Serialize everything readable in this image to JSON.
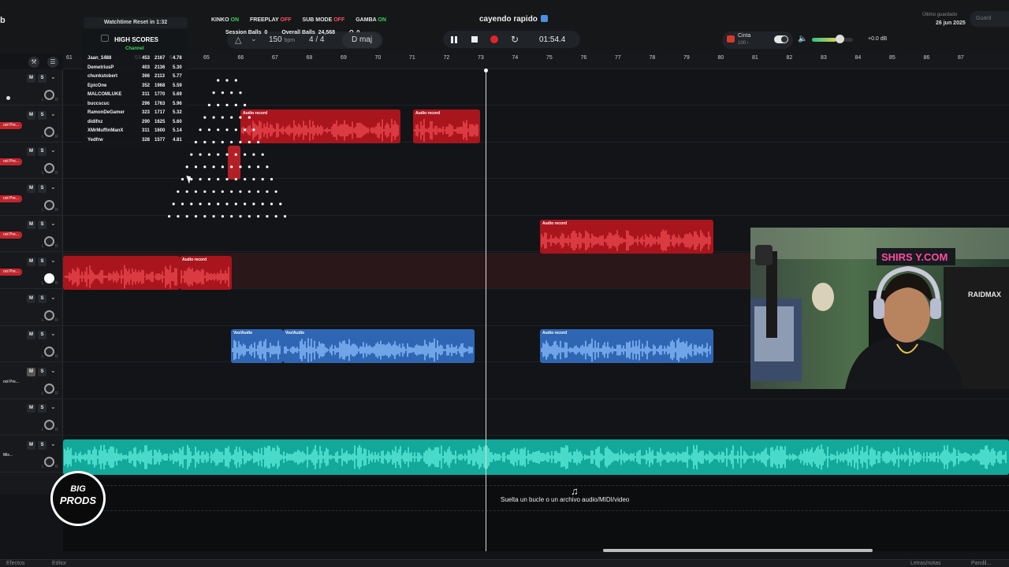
{
  "topbar": {
    "left_char": "b",
    "watchtime": "Watchtime Reset in 1:32",
    "modes": [
      {
        "label": "KINKO",
        "state": "ON"
      },
      {
        "label": "FREEPLAY",
        "state": "OFF"
      },
      {
        "label": "SUB MODE",
        "state": "OFF"
      },
      {
        "label": "GAMBA",
        "state": "ON"
      }
    ],
    "session_balls_label": "Session Balls",
    "session_balls": "0",
    "overall_balls_label": "Overall Balls",
    "overall_balls": "24,568",
    "q_label": "Q",
    "q_value": "0",
    "bpm": "150",
    "bpm_unit": "bpm",
    "time_sig": "4 / 4",
    "key": "D maj",
    "project_title": "cayendo rapido",
    "timecode": "01:54.4",
    "cinta_label": "Cinta",
    "cinta_value": "100",
    "volume_db": "+0.0 dB",
    "volume_level": 0.6,
    "saved_label": "Último guardado",
    "saved_date": "26 jun 2025",
    "save_button": "Guard"
  },
  "ruler": {
    "ticks": [
      "61",
      "62",
      "63",
      "64",
      "65",
      "66",
      "67",
      "68",
      "69",
      "70",
      "71",
      "72",
      "73",
      "74",
      "75",
      "76",
      "77",
      "78",
      "79",
      "80",
      "81",
      "82",
      "83",
      "84",
      "85",
      "86",
      "87"
    ]
  },
  "high_scores": {
    "title": "HIGH SCORES",
    "subtitle": "Channel",
    "rows": [
      {
        "name": "Jaan_1488",
        "a": "453",
        "b": "2167",
        "c": "4.78"
      },
      {
        "name": "DemetriusP",
        "a": "403",
        "b": "2136",
        "c": "5.30"
      },
      {
        "name": "chunkstobert",
        "a": "366",
        "b": "2113",
        "c": "5.77"
      },
      {
        "name": "EpicOne",
        "a": "352",
        "b": "1968",
        "c": "5.59"
      },
      {
        "name": "MALCOMLUKE",
        "a": "311",
        "b": "1770",
        "c": "5.69"
      },
      {
        "name": "buccscuc",
        "a": "296",
        "b": "1763",
        "c": "5.96"
      },
      {
        "name": "RamonDeGamer",
        "a": "323",
        "b": "1717",
        "c": "5.32"
      },
      {
        "name": "didifnz",
        "a": "290",
        "b": "1625",
        "c": "5.60"
      },
      {
        "name": "XMrMuffinManX",
        "a": "311",
        "b": "1600",
        "c": "5.14"
      },
      {
        "name": "Yedfrw",
        "a": "328",
        "b": "1577",
        "c": "4.81"
      }
    ]
  },
  "tracks": [
    {
      "label": "",
      "mute": "M",
      "solo": "S"
    },
    {
      "label": "ool Pre...",
      "mute": "M",
      "solo": "S"
    },
    {
      "label": "ool Pre...",
      "mute": "M",
      "solo": "S"
    },
    {
      "label": "ool Pre...",
      "mute": "M",
      "solo": "S"
    },
    {
      "label": "ool Pre...",
      "mute": "M",
      "solo": "S"
    },
    {
      "label": "ool Pre...",
      "mute": "M",
      "solo": "S"
    },
    {
      "label": "",
      "mute": "M",
      "solo": "S"
    },
    {
      "label": "",
      "mute": "M",
      "solo": "S"
    },
    {
      "label": "ool Pre...",
      "mute": "M",
      "solo": "S"
    },
    {
      "label": "",
      "mute": "M",
      "solo": "S"
    },
    {
      "label": "Mix...",
      "mute": "M",
      "solo": "S"
    }
  ],
  "knob_labels": {
    "left": "L",
    "right": "R"
  },
  "clips": {
    "audio_record": "Audio record",
    "voz_audio": "Voz/Audio"
  },
  "drop_zone": {
    "text": "Suelta un bucle o un archivo audio/MIDI/video"
  },
  "webcam": {
    "sign_text": "SHIRS Y.COM",
    "chair_brand": "RAIDMAX"
  },
  "logo": {
    "line1": "BIG",
    "line2": "PRODS"
  },
  "bottombar": {
    "efectos": "Efectos",
    "editor": "Editor",
    "letras": "Letras/notas",
    "pandil": "Pandil..."
  },
  "colors": {
    "red_clip": "#a9151d",
    "blue_clip": "#2f66b3",
    "teal_clip": "#12a89a",
    "on": "#39d353",
    "off": "#ff4d5e"
  }
}
